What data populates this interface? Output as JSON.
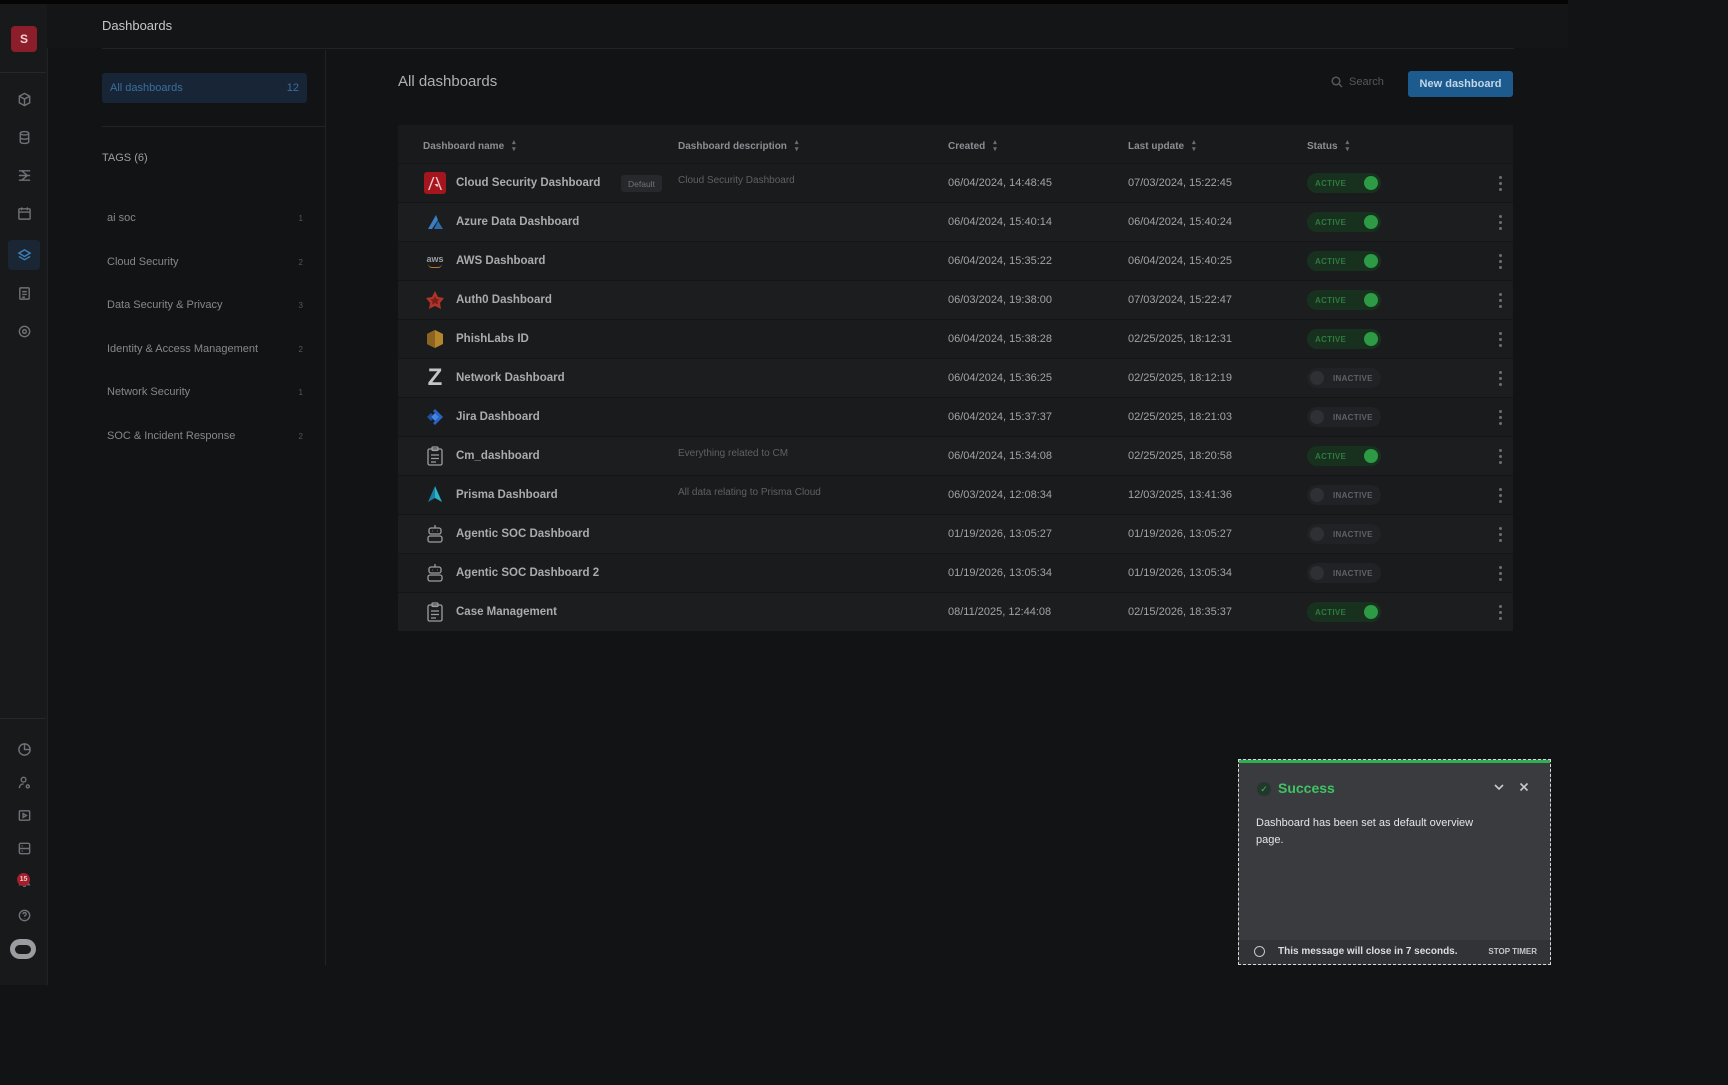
{
  "header": {
    "title": "Dashboards"
  },
  "user": {
    "avatar_letter": "S"
  },
  "rail": {
    "notification_count": "15"
  },
  "tags_panel": {
    "all_label": "All dashboards",
    "all_count": "12",
    "tags_heading": "TAGS (6)",
    "tags": [
      {
        "name": "ai soc",
        "count": "1"
      },
      {
        "name": "Cloud Security",
        "count": "2"
      },
      {
        "name": "Data Security & Privacy",
        "count": "3"
      },
      {
        "name": "Identity & Access Management",
        "count": "2"
      },
      {
        "name": "Network Security",
        "count": "1"
      },
      {
        "name": "SOC & Incident Response",
        "count": "2"
      }
    ]
  },
  "main": {
    "title": "All dashboards",
    "search_placeholder": "Search",
    "new_button": "New dashboard",
    "columns": [
      "Dashboard name",
      "Dashboard description",
      "Created",
      "Last update",
      "Status"
    ],
    "default_tag": "Default",
    "rows": [
      {
        "name": "Cloud Security Dashboard",
        "description": "Cloud Security Dashboard",
        "created": "06/04/2024, 14:48:45",
        "updated": "07/03/2024, 15:22:45",
        "status": "ACTIVE",
        "icon": "adobe-icon"
      },
      {
        "name": "Azure Data Dashboard",
        "description": "",
        "created": "06/04/2024, 15:40:14",
        "updated": "06/04/2024, 15:40:24",
        "status": "ACTIVE",
        "icon": "azure-icon"
      },
      {
        "name": "AWS Dashboard",
        "description": "",
        "created": "06/04/2024, 15:35:22",
        "updated": "06/04/2024, 15:40:25",
        "status": "ACTIVE",
        "icon": "aws-icon"
      },
      {
        "name": "Auth0 Dashboard",
        "description": "",
        "created": "06/03/2024, 19:38:00",
        "updated": "07/03/2024, 15:22:47",
        "status": "ACTIVE",
        "icon": "auth0-icon"
      },
      {
        "name": "PhishLabs ID",
        "description": "",
        "created": "06/04/2024, 15:38:28",
        "updated": "02/25/2025, 18:12:31",
        "status": "ACTIVE",
        "icon": "phishlabs-icon"
      },
      {
        "name": "Network Dashboard",
        "description": "",
        "created": "06/04/2024, 15:36:25",
        "updated": "02/25/2025, 18:12:19",
        "status": "INACTIVE",
        "icon": "zscaler-icon"
      },
      {
        "name": "Jira Dashboard",
        "description": "",
        "created": "06/04/2024, 15:37:37",
        "updated": "02/25/2025, 18:21:03",
        "status": "INACTIVE",
        "icon": "jira-icon"
      },
      {
        "name": "Cm_dashboard",
        "description": "Everything related to CM",
        "created": "06/04/2024, 15:34:08",
        "updated": "02/25/2025, 18:20:58",
        "status": "ACTIVE",
        "icon": "clipboard-icon"
      },
      {
        "name": "Prisma Dashboard",
        "description": "All data relating to Prisma Cloud",
        "created": "06/03/2024, 12:08:34",
        "updated": "12/03/2025, 13:41:36",
        "status": "INACTIVE",
        "icon": "prisma-icon"
      },
      {
        "name": "Agentic SOC Dashboard",
        "description": "",
        "created": "01/19/2026, 13:05:27",
        "updated": "01/19/2026, 13:05:27",
        "status": "INACTIVE",
        "icon": "robot-icon"
      },
      {
        "name": "Agentic SOC Dashboard 2",
        "description": "",
        "created": "01/19/2026, 13:05:34",
        "updated": "01/19/2026, 13:05:34",
        "status": "INACTIVE",
        "icon": "robot-icon"
      },
      {
        "name": "Case Management",
        "description": "",
        "created": "08/11/2025, 12:44:08",
        "updated": "02/15/2026, 18:35:37",
        "status": "ACTIVE",
        "icon": "clipboard-icon"
      }
    ]
  },
  "toast": {
    "title": "Success",
    "message": "Dashboard has been set as default overview page.",
    "footer": "This message will close in 7 seconds.",
    "stop_label": "STOP TIMER",
    "accent": "#3ec463"
  },
  "colors": {
    "primary": "#1d5a8e",
    "active": "#2d9a46",
    "error": "#8c1d2a"
  }
}
